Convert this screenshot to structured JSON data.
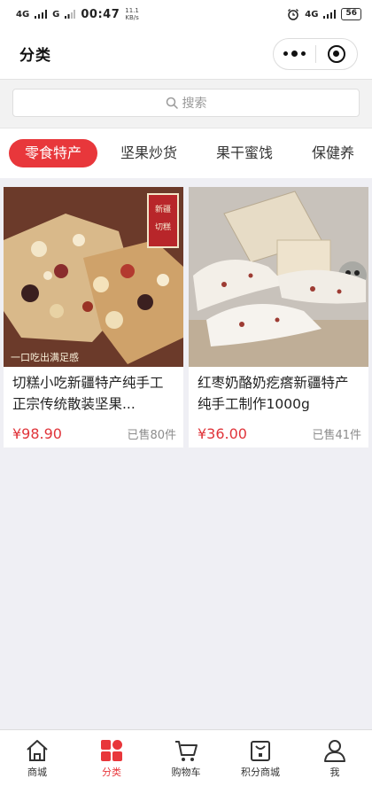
{
  "status_bar": {
    "signal_left": "4G",
    "signal_right": "G",
    "time": "00:47",
    "speed_value": "11.1",
    "speed_unit": "KB/s",
    "right_signal": "4G",
    "battery": "56"
  },
  "header": {
    "title": "分类"
  },
  "search": {
    "placeholder": "搜索"
  },
  "category_tabs": [
    {
      "label": "零食特产",
      "active": true
    },
    {
      "label": "坚果炒货",
      "active": false
    },
    {
      "label": "果干蜜饯",
      "active": false
    },
    {
      "label": "保健养",
      "active": false
    }
  ],
  "products": [
    {
      "title": "切糕小吃新疆特产纯手工正宗传统散装坚果...",
      "price": "¥98.90",
      "sold": "已售80件",
      "image_badge": "新疆切糕",
      "image_caption": "一口吃出满足感"
    },
    {
      "title": "红枣奶酪奶疙瘩新疆特产纯手工制作1000g",
      "price": "¥36.00",
      "sold": "已售41件"
    }
  ],
  "tabbar": [
    {
      "label": "商城",
      "icon": "home-icon",
      "active": false
    },
    {
      "label": "分类",
      "icon": "category-icon",
      "active": true
    },
    {
      "label": "购物车",
      "icon": "cart-icon",
      "active": false
    },
    {
      "label": "积分商城",
      "icon": "points-bag-icon",
      "active": false
    },
    {
      "label": "我",
      "icon": "user-icon",
      "active": false
    }
  ],
  "colors": {
    "accent": "#e8373b",
    "price": "#e0343a",
    "background": "#efeff4"
  }
}
